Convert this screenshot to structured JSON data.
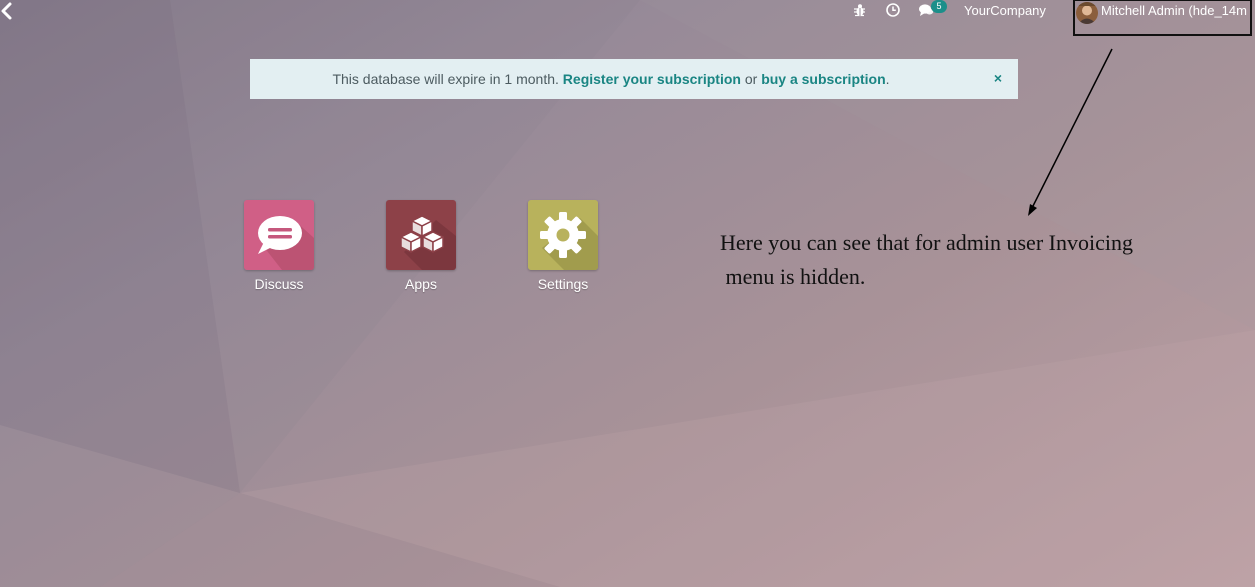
{
  "navbar": {
    "back_icon": "chevron-left-icon",
    "systray": {
      "debug_icon": "bug-icon",
      "activity_icon": "clock-icon",
      "messaging_icon": "comments-icon",
      "messaging_count": "5"
    },
    "company": "YourCompany",
    "user": {
      "name": "Mitchell Admin (hde_14m"
    }
  },
  "banner": {
    "text_before": "This database will expire in 1 month. ",
    "register_link": "Register your subscription",
    "text_middle": " or ",
    "buy_link": "buy a subscription",
    "text_after": ".",
    "close_label": "×"
  },
  "apps": [
    {
      "label": "Discuss",
      "icon": "speech-bubble-icon",
      "color": "#d05f86"
    },
    {
      "label": "Apps",
      "icon": "cubes-icon",
      "color": "#8d4148"
    },
    {
      "label": "Settings",
      "icon": "gear-icon",
      "color": "#b8b25c"
    }
  ],
  "annotation": {
    "line1": "Here you can see that for admin user Invoicing",
    "line2": " menu is hidden."
  },
  "colors": {
    "accent": "#1a8583",
    "banner_bg": "#e3eff2",
    "badge": "#1c8f8a"
  }
}
